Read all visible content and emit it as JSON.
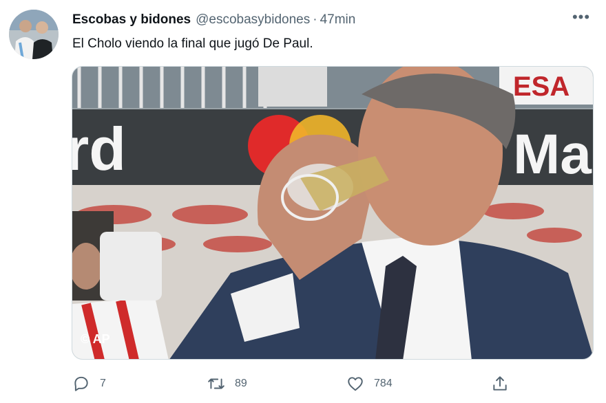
{
  "tweet": {
    "author_name": "Escobas y bidones",
    "handle": "@escobasybidones",
    "separator": "·",
    "time": "47min",
    "text": "El Cholo viendo la final que jugó De Paul.",
    "more_icon": "more-horizontal-icon",
    "more_label": "•••"
  },
  "media": {
    "alt": "Hombre de traje bebiendo de una copa",
    "banner_left_text": "rd",
    "banner_right_text": "Ma",
    "top_right_text": "ESA",
    "watermark": "© AP"
  },
  "actions": {
    "reply": {
      "icon": "reply-icon",
      "count": "7"
    },
    "retweet": {
      "icon": "retweet-icon",
      "count": "89"
    },
    "like": {
      "icon": "heart-icon",
      "count": "784"
    },
    "share": {
      "icon": "share-icon"
    }
  }
}
